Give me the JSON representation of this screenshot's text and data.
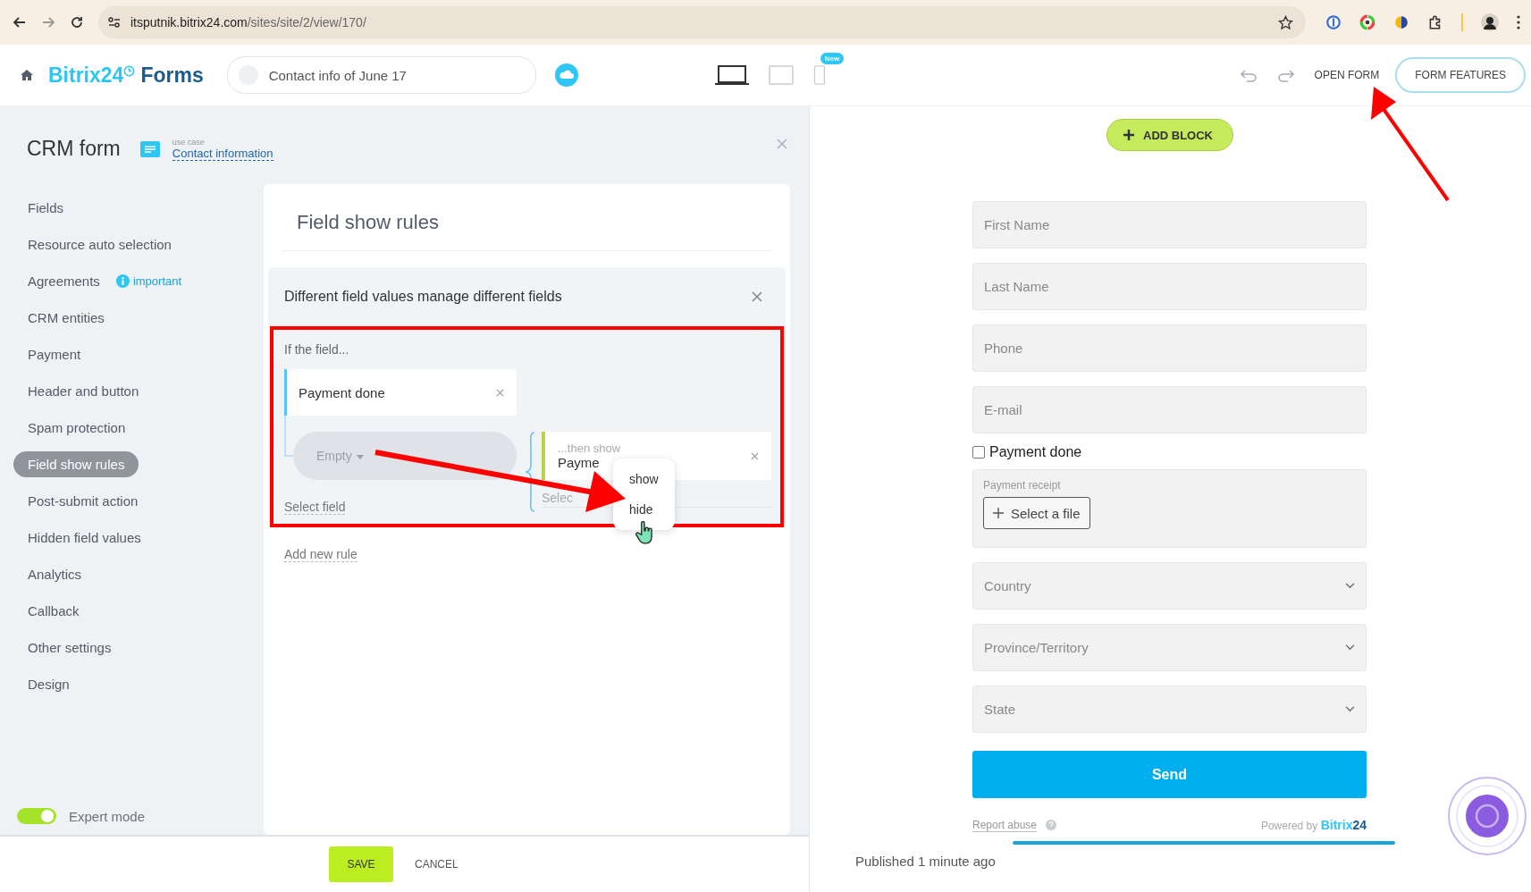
{
  "browser": {
    "url_host": "itsputnik.bitrix24.com",
    "url_path": "/sites/site/2/view/170/"
  },
  "header": {
    "logo_brand": "Bitrix24",
    "logo_product": "Forms",
    "form_name": "Contact info of June 17",
    "new_badge": "New",
    "devices": [
      {
        "kind": "desktop",
        "selected": true
      },
      {
        "kind": "tablet",
        "selected": false
      },
      {
        "kind": "mobile",
        "selected": false
      }
    ],
    "open_form": "OPEN FORM",
    "form_features": "FORM FEATURES"
  },
  "panel": {
    "title": "CRM form",
    "use_case_label": "use case",
    "use_case": "Contact information"
  },
  "sidebar": {
    "items": [
      {
        "label": "Fields",
        "selected": false
      },
      {
        "label": "Resource auto selection",
        "selected": false
      },
      {
        "label": "Agreements",
        "selected": false,
        "badge": "important"
      },
      {
        "label": "CRM entities",
        "selected": false
      },
      {
        "label": "Payment",
        "selected": false
      },
      {
        "label": "Header and button",
        "selected": false
      },
      {
        "label": "Spam protection",
        "selected": false
      },
      {
        "label": "Field show rules",
        "selected": true
      },
      {
        "label": "Post-submit action",
        "selected": false
      },
      {
        "label": "Hidden field values",
        "selected": false
      },
      {
        "label": "Analytics",
        "selected": false
      },
      {
        "label": "Callback",
        "selected": false
      },
      {
        "label": "Other settings",
        "selected": false
      },
      {
        "label": "Design",
        "selected": false
      }
    ],
    "expert_mode": {
      "label": "Expert mode",
      "on": true
    }
  },
  "rules": {
    "title": "Field show rules",
    "group_title": "Different field values manage different fields",
    "if_label": "If the field...",
    "field": "Payment done",
    "condition": "Empty",
    "then_label": "...then show",
    "target": "Payme",
    "target_select": "Selec",
    "menu": [
      "show",
      "hide"
    ],
    "select_field": "Select field",
    "add_rule": "Add new rule"
  },
  "footer": {
    "save": "SAVE",
    "cancel": "CANCEL"
  },
  "preview": {
    "add_block": "ADD BLOCK",
    "fields": [
      {
        "kind": "text",
        "placeholder": "First Name"
      },
      {
        "kind": "text",
        "placeholder": "Last Name"
      },
      {
        "kind": "text",
        "placeholder": "Phone"
      },
      {
        "kind": "text",
        "placeholder": "E-mail"
      },
      {
        "kind": "checkbox",
        "label": "Payment done",
        "checked": false
      },
      {
        "kind": "file",
        "label": "Payment receipt",
        "button": "Select a file"
      },
      {
        "kind": "select",
        "placeholder": "Country"
      },
      {
        "kind": "select",
        "placeholder": "Province/Territory"
      },
      {
        "kind": "select",
        "placeholder": "State"
      }
    ],
    "send": "Send",
    "report_abuse": "Report abuse",
    "powered_by": "Powered by",
    "brand": "Bitrix",
    "brand_num": "24",
    "published": "Published 1 minute ago"
  }
}
